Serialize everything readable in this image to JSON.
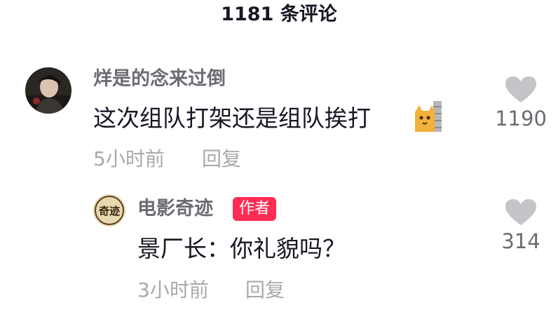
{
  "header": {
    "title": "1181 条评论"
  },
  "comments": [
    {
      "username": "烊是的念来过倒",
      "text": "这次组队打架还是组队挨打",
      "emoji": "cat-peek-icon",
      "time": "5小时前",
      "reply_label": "回复",
      "likes": "1190"
    }
  ],
  "replies": [
    {
      "username": "电影奇迹",
      "badge": "作者",
      "text": "景厂长：你礼貌吗？",
      "time": "3小时前",
      "reply_label": "回复",
      "likes": "314",
      "avatar_text": "奇迹"
    }
  ],
  "colors": {
    "badge": "#fe2c55",
    "username": "#6b6c73",
    "meta": "#a8a9ae",
    "heart": "#c4c5c8"
  }
}
